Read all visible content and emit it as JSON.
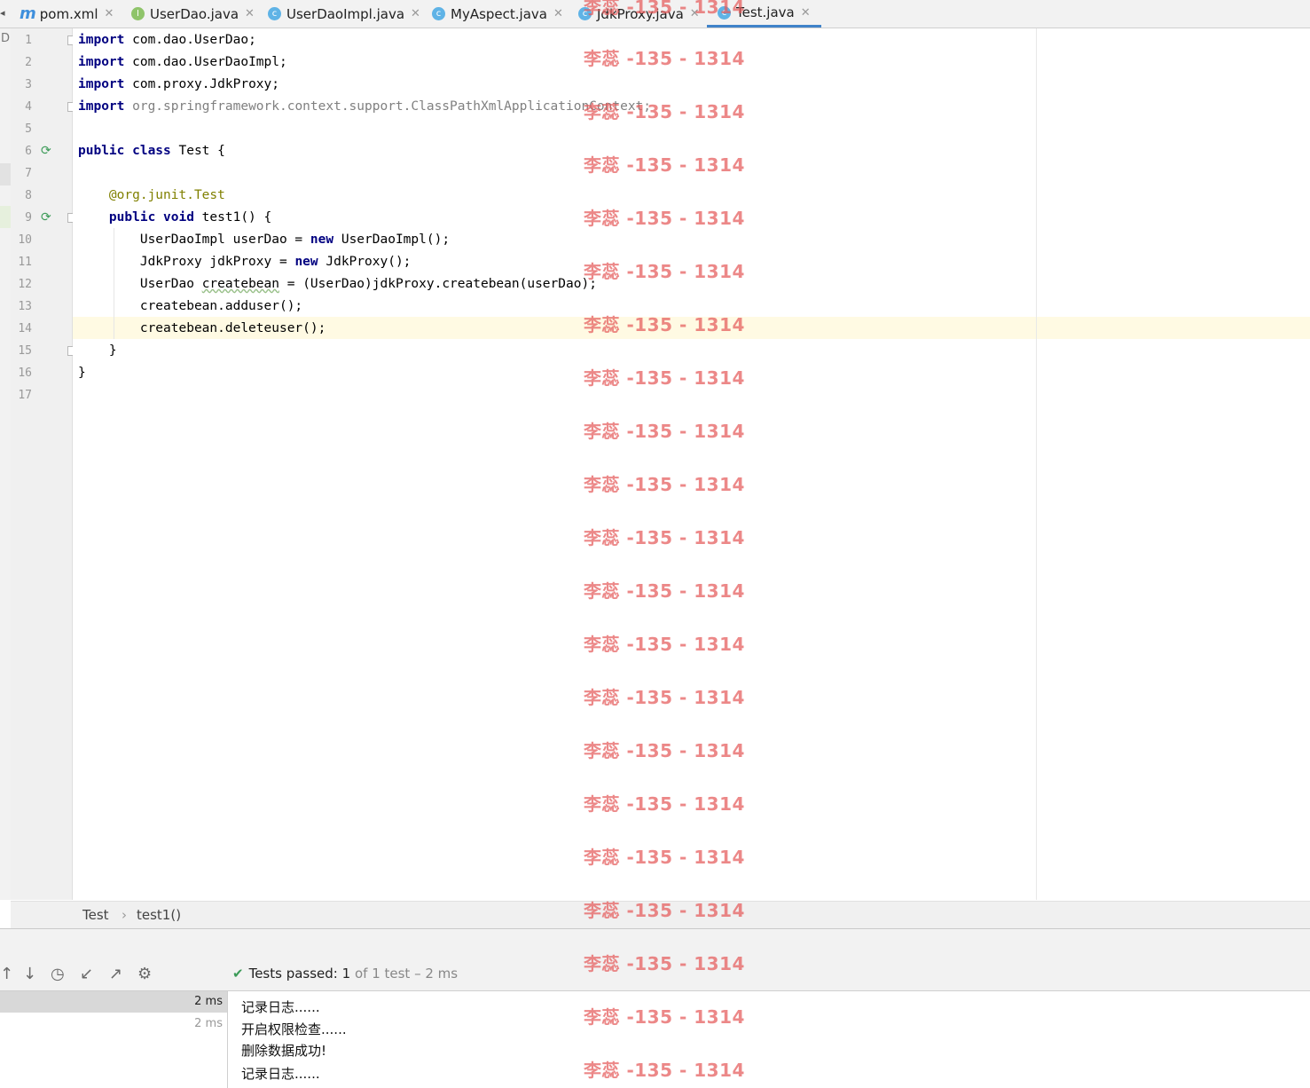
{
  "tabs": [
    {
      "label": "pom.xml",
      "icon": "maven-file-icon",
      "glyph": "m"
    },
    {
      "label": "UserDao.java",
      "icon": "interface-icon",
      "glyph": "I"
    },
    {
      "label": "UserDaoImpl.java",
      "icon": "class-icon",
      "glyph": "c"
    },
    {
      "label": "MyAspect.java",
      "icon": "class-icon",
      "glyph": "c"
    },
    {
      "label": "JdkProxy.java",
      "icon": "class-icon",
      "glyph": "c"
    },
    {
      "label": "Test.java",
      "icon": "test-class-icon",
      "glyph": "c",
      "active": true
    }
  ],
  "left_strip_letter": "D",
  "line_numbers": [
    "1",
    "2",
    "3",
    "4",
    "5",
    "6",
    "7",
    "8",
    "9",
    "10",
    "11",
    "12",
    "13",
    "14",
    "15",
    "16",
    "17"
  ],
  "code": {
    "l1_kw": "import",
    "l1_rest": " com.dao.UserDao;",
    "l2_kw": "import",
    "l2_rest": " com.dao.UserDaoImpl;",
    "l3_kw": "import",
    "l3_rest": " com.proxy.JdkProxy;",
    "l4_kw": "import",
    "l4_rest": " org.springframework.context.support.ClassPathXmlApplicationContext;",
    "l6_kw": "public class",
    "l6_rest": " Test {",
    "l8_ann_prefix": "    @org.junit.",
    "l8_ann_name": "Test",
    "l9_kw": "    public void",
    "l9_rest": " test1() {",
    "l10_pre": "        UserDaoImpl userDao = ",
    "l10_kw": "new",
    "l10_post": " UserDaoImpl();",
    "l11_pre": "        JdkProxy jdkProxy = ",
    "l11_kw": "new",
    "l11_post": " JdkProxy();",
    "l12_pre": "        UserDao ",
    "l12_var": "createbean",
    "l12_post": " = (UserDao)jdkProxy.createbean(userDao);",
    "l13": "        createbean.adduser();",
    "l14": "        createbean.deleteuser();",
    "l15": "    }",
    "l16": "}"
  },
  "breadcrumb": {
    "class": "Test",
    "separator": "›",
    "method": "test1()"
  },
  "run": {
    "status_check": "✔",
    "status_label": "Tests passed:",
    "status_count": "1",
    "status_detail": "of 1 test – 2 ms",
    "tree": [
      "2 ms",
      "2 ms"
    ],
    "console": [
      "记录日志......",
      "开启权限检查......",
      "删除数据成功!",
      "记录日志......"
    ]
  },
  "toolbar_icons": [
    "arrow-up-icon",
    "arrow-down-icon",
    "history-icon",
    "import-icon",
    "export-icon",
    "gear-icon"
  ],
  "watermark": "李蕊 -135 - 1314",
  "colors": {
    "keyword": "#000080",
    "annotation": "#808000",
    "watermark": "#e55a5a",
    "pass": "#3c9b58",
    "active_tab": "#4083c9"
  }
}
